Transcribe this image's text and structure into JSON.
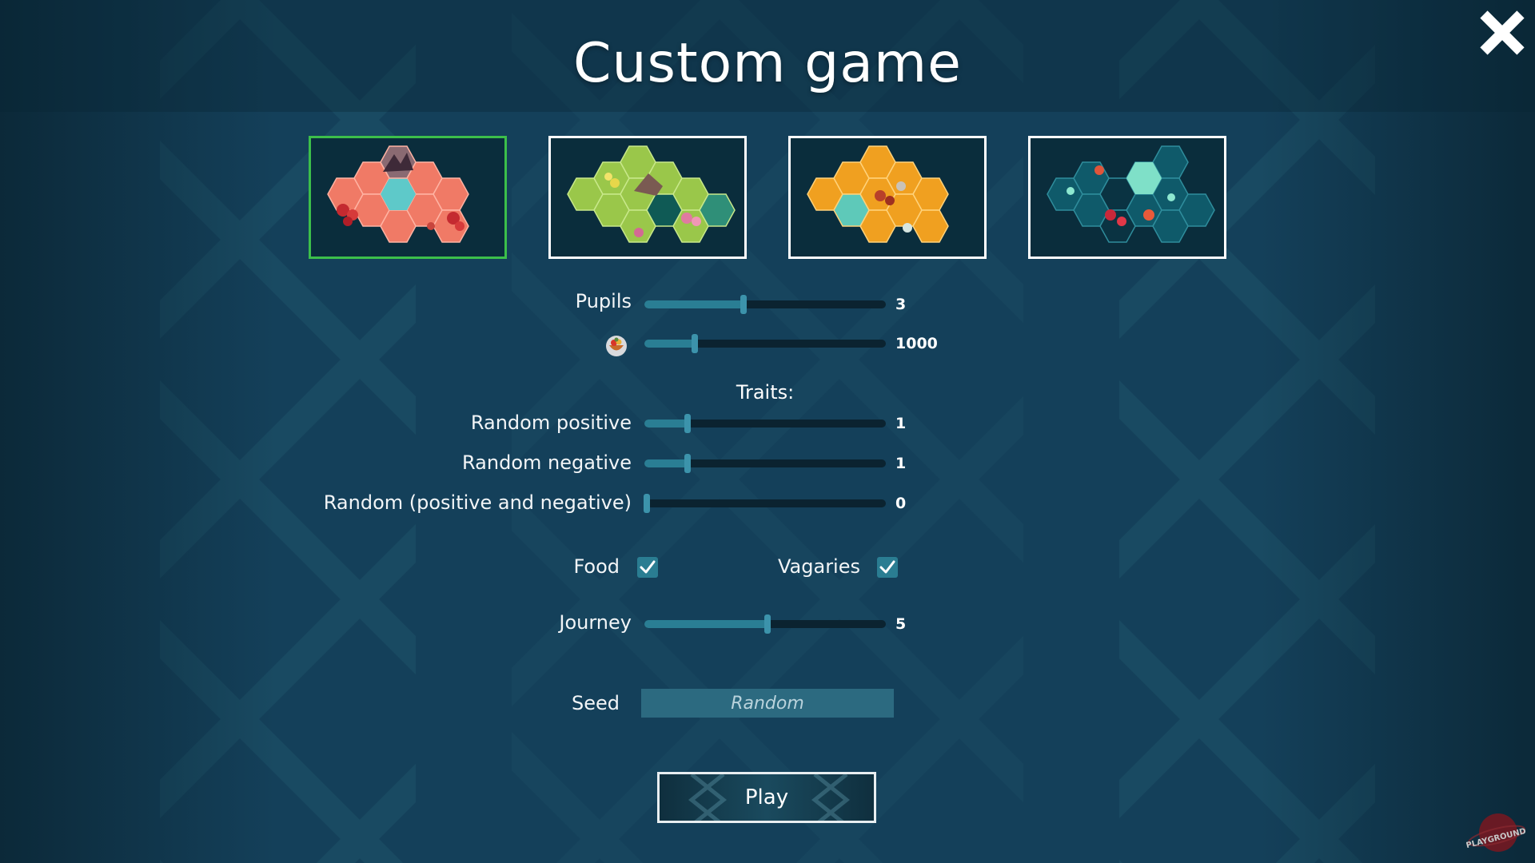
{
  "title": "Custom game",
  "close_icon": "close-x-icon",
  "maps": [
    {
      "name": "coral-biome",
      "selected": true
    },
    {
      "name": "green-biome",
      "selected": false
    },
    {
      "name": "amber-biome",
      "selected": false
    },
    {
      "name": "teal-biome",
      "selected": false
    }
  ],
  "settings": {
    "pupils": {
      "label": "Pupils",
      "value": "3",
      "fraction": 0.41
    },
    "food_amount": {
      "icon": "food-bowl-icon",
      "value": "1000",
      "fraction": 0.21
    },
    "traits_label": "Traits:",
    "random_positive": {
      "label": "Random positive",
      "value": "1",
      "fraction": 0.18
    },
    "random_negative": {
      "label": "Random negative",
      "value": "1",
      "fraction": 0.18
    },
    "random_both": {
      "label": "Random (positive and negative)",
      "value": "0",
      "fraction": 0.01
    },
    "food": {
      "label": "Food",
      "checked": true
    },
    "vagaries": {
      "label": "Vagaries",
      "checked": true
    },
    "journey": {
      "label": "Journey",
      "value": "5",
      "fraction": 0.51
    },
    "seed": {
      "label": "Seed",
      "placeholder": "Random"
    }
  },
  "play_label": "Play",
  "colors": {
    "background": "#12384a",
    "selected_border": "#3cbf4a",
    "slider_fill": "#2a7e94",
    "slider_track": "#0b2330"
  },
  "logo_text": "PLAYGROUND"
}
